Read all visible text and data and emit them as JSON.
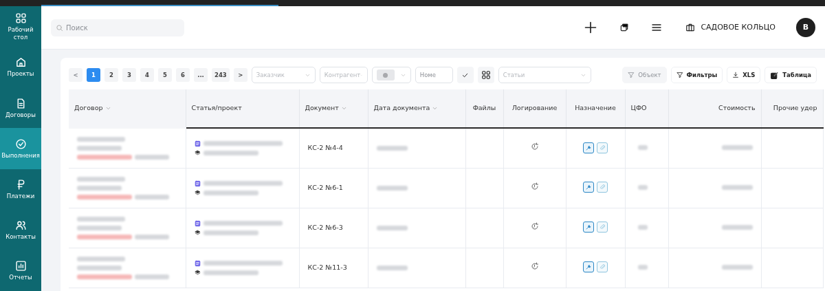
{
  "sidebar": {
    "items": [
      {
        "label": "Рабочий стол",
        "selected": false
      },
      {
        "label": "Проекты",
        "selected": false
      },
      {
        "label": "Договоры",
        "selected": false
      },
      {
        "label": "Выполнения",
        "selected": true
      },
      {
        "label": "Платежи",
        "selected": false
      },
      {
        "label": "Контакты",
        "selected": false
      },
      {
        "label": "Отчеты",
        "selected": false
      }
    ]
  },
  "header": {
    "search": {
      "placeholder": "Поиск"
    },
    "organization": "САДОВОЕ КОЛЬЦО",
    "avatar": "В"
  },
  "pagination": {
    "prev": "<",
    "next": ">",
    "pages": [
      {
        "label": "1",
        "selected": true
      },
      {
        "label": "2",
        "selected": false
      },
      {
        "label": "3",
        "selected": false
      },
      {
        "label": "4",
        "selected": false
      },
      {
        "label": "5",
        "selected": false
      },
      {
        "label": "6",
        "selected": false
      },
      {
        "label": "...",
        "selected": false
      },
      {
        "label": "243",
        "selected": false
      }
    ]
  },
  "filters": [
    {
      "kind": "select",
      "placeholder": "Заказчик"
    },
    {
      "kind": "select",
      "placeholder": "Контрагент"
    },
    {
      "kind": "color"
    },
    {
      "kind": "input",
      "placeholder": "Номе"
    },
    {
      "kind": "check"
    },
    {
      "kind": "grid"
    },
    {
      "kind": "wide",
      "placeholder": "Статьи"
    }
  ],
  "buttons": [
    {
      "label": "Объект",
      "disabled": true
    },
    {
      "label": "Фильтры",
      "disabled": false
    },
    {
      "label": "XLS",
      "disabled": false
    },
    {
      "label": "Таблица",
      "disabled": false
    }
  ],
  "table": {
    "columns": [
      {
        "label": "Договор",
        "sortable": true
      },
      {
        "label": "Статья/проект",
        "sortable": false
      },
      {
        "label": "Документ",
        "sortable": true
      },
      {
        "label": "Дата документа",
        "sortable": true
      },
      {
        "label": "Файлы",
        "sortable": false
      },
      {
        "label": "Логирование",
        "sortable": false
      },
      {
        "label": "Назначение",
        "sortable": false
      },
      {
        "label": "ЦФО",
        "sortable": false
      },
      {
        "label": "Стоимость",
        "sortable": false
      },
      {
        "label": "Прочие удер",
        "sortable": false
      }
    ],
    "rows": [
      {
        "document": "КС-2 №4-4",
        "attach_active": false
      },
      {
        "document": "КС-2 №6-1",
        "attach_active": false
      },
      {
        "document": "КС-2 №6-3",
        "attach_active": false
      },
      {
        "document": "КС-2 №11-3",
        "attach_active": false
      }
    ]
  }
}
